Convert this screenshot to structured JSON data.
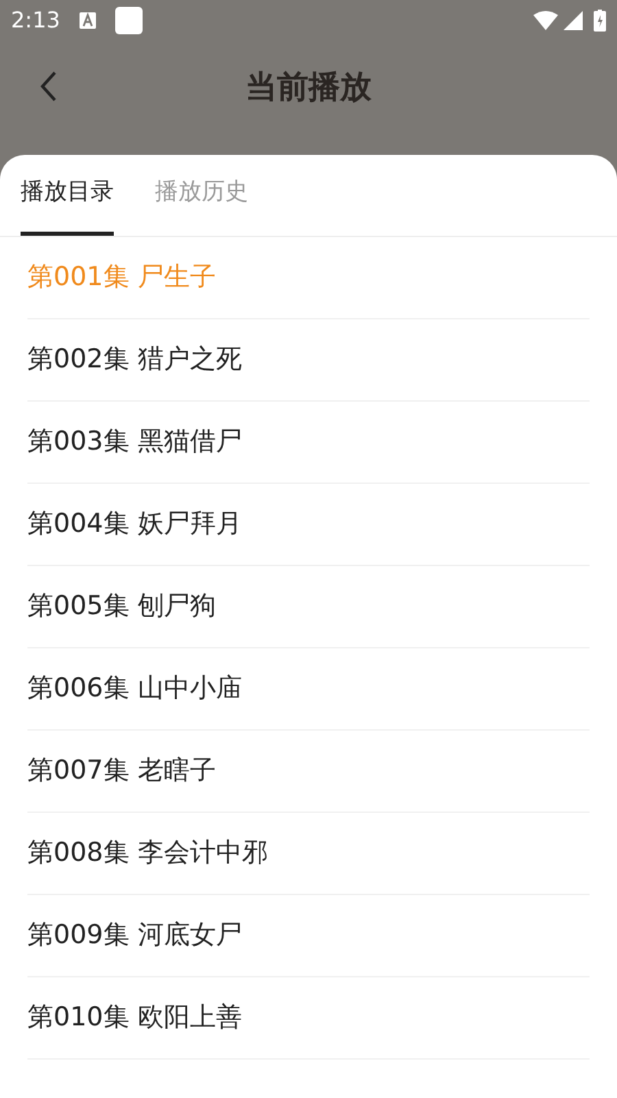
{
  "status_bar": {
    "time": "2:13"
  },
  "header": {
    "title": "当前播放"
  },
  "tabs": [
    {
      "label": "播放目录",
      "selected": true
    },
    {
      "label": "播放历史",
      "selected": false
    }
  ],
  "episodes": [
    {
      "label": "第001集 尸生子",
      "selected": true
    },
    {
      "label": "第002集 猎户之死",
      "selected": false
    },
    {
      "label": "第003集 黑猫借尸",
      "selected": false
    },
    {
      "label": "第004集 妖尸拜月",
      "selected": false
    },
    {
      "label": "第005集 刨尸狗",
      "selected": false
    },
    {
      "label": "第006集 山中小庙",
      "selected": false
    },
    {
      "label": "第007集 老瞎子",
      "selected": false
    },
    {
      "label": "第008集 李会计中邪",
      "selected": false
    },
    {
      "label": "第009集 河底女尸",
      "selected": false
    },
    {
      "label": "第010集 欧阳上善",
      "selected": false
    }
  ]
}
